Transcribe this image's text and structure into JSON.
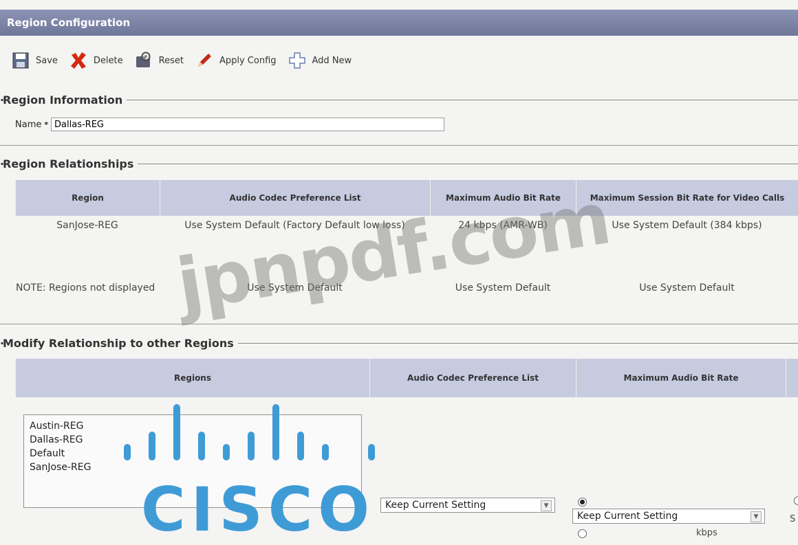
{
  "window": {
    "title": "Region Configuration"
  },
  "toolbar": {
    "save_label": "Save",
    "delete_label": "Delete",
    "reset_label": "Reset",
    "apply_label": "Apply Config",
    "add_label": "Add New"
  },
  "region_info": {
    "heading": "Region Information",
    "name_label": "Name",
    "required_mark": "*",
    "name_value": "Dallas-REG"
  },
  "relationships": {
    "heading": "Region Relationships",
    "columns": [
      "Region",
      "Audio Codec Preference List",
      "Maximum Audio Bit Rate",
      "Maximum Session Bit Rate for Video Calls"
    ],
    "rows": [
      [
        "SanJose-REG",
        "Use System Default (Factory Default low loss)",
        "24 kbps (AMR-WB)",
        "Use System Default (384 kbps)"
      ],
      [
        "NOTE: Regions not displayed",
        "Use System Default",
        "Use System Default",
        "Use System Default"
      ]
    ]
  },
  "modify": {
    "heading": "Modify Relationship to other Regions",
    "columns": [
      "Regions",
      "Audio Codec Preference List",
      "Maximum Audio Bit Rate"
    ],
    "regions_list": [
      "Austin-REG",
      "Dallas-REG",
      "Default",
      "SanJose-REG"
    ],
    "codec_select": "Keep Current Setting",
    "bitrate_select": "Keep Current Setting",
    "bitrate_unit": "kbps",
    "cut_off_label": "S"
  },
  "overlay": {
    "watermark": "jpnpdf.com",
    "logo_text": "CISCO"
  },
  "colors": {
    "title_bar": "#7a82a4",
    "table_header": "#c7cbe0",
    "cisco_blue": "#3f9bd6"
  }
}
